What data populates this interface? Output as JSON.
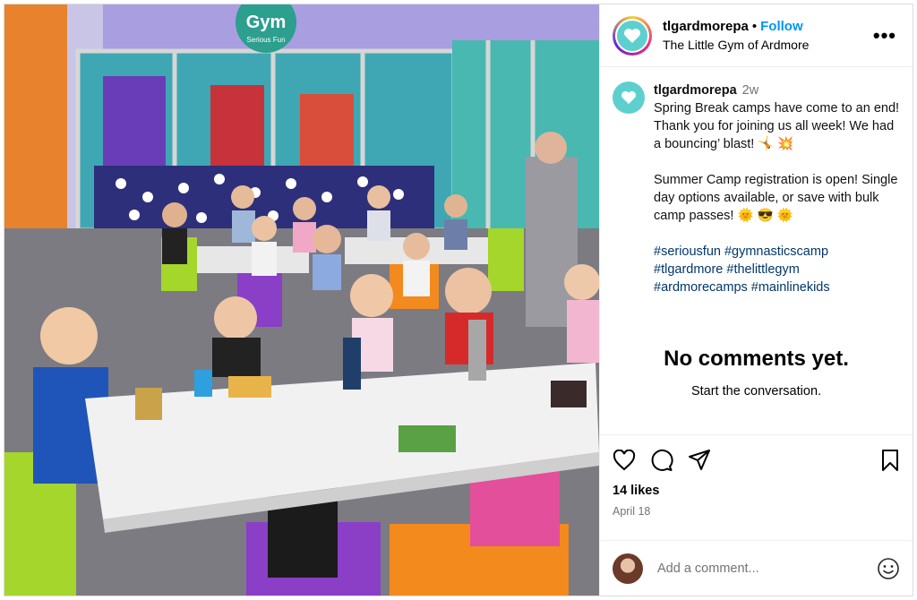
{
  "photo": {
    "sign_text": "Gym",
    "sign_sub": "Serious Fun"
  },
  "header": {
    "username": "tlgardmorepa",
    "separator": "•",
    "follow_label": "Follow",
    "subtitle": "The Little Gym of Ardmore",
    "more_icon": "•••"
  },
  "caption": {
    "username": "tlgardmorepa",
    "time": "2w",
    "para1": "Spring Break camps have come to an end! Thank you for joining us all week! We had a bouncing’ blast! 🤸 💥",
    "para2": "Summer Camp registration is open! Single day options available, or save with bulk camp passes! 🌞 😎 🌞",
    "tags": [
      "#seriousfun",
      "#gymnasticscamp",
      "#tlgardmore",
      "#thelittlegym",
      "#ardmorecamps",
      "#mainlinekids"
    ]
  },
  "comments": {
    "empty_title": "No comments yet.",
    "empty_sub": "Start the conversation."
  },
  "actions": {
    "icons": [
      "heart-icon",
      "comment-icon",
      "share-icon",
      "bookmark-icon"
    ],
    "likes": "14 likes",
    "date": "April 18"
  },
  "add_comment": {
    "placeholder": "Add a comment..."
  },
  "colors": {
    "follow": "#0095f6",
    "logo_teal": "#5ecfcf",
    "hashtag": "#385898"
  }
}
